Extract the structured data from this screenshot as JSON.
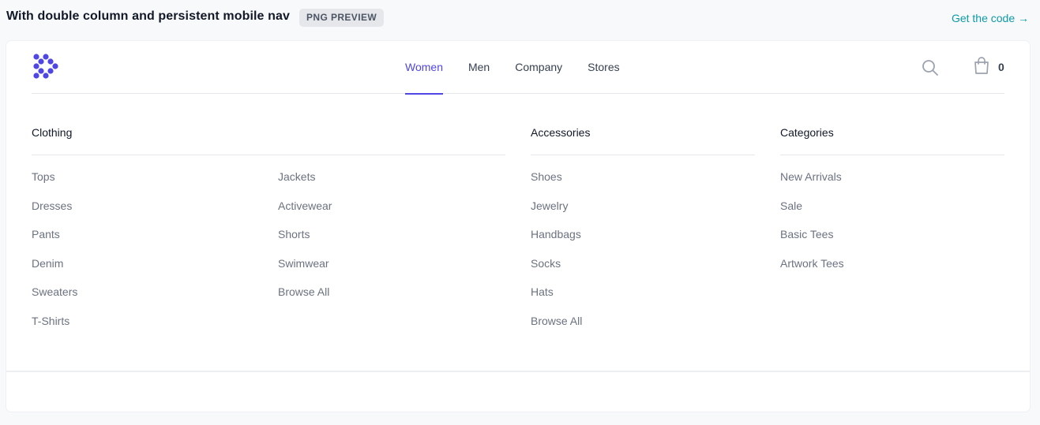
{
  "page": {
    "title": "With double column and persistent mobile nav",
    "badge": "PNG PREVIEW",
    "get_code": "Get the code →"
  },
  "nav": {
    "logo_icon": "workflow-logo-icon",
    "items": [
      {
        "label": "Women",
        "active": true
      },
      {
        "label": "Men"
      },
      {
        "label": "Company"
      },
      {
        "label": "Stores"
      }
    ],
    "search_icon": "search-icon",
    "cart_icon": "shopping-bag-icon",
    "cart_count": "0"
  },
  "menu": {
    "clothing": {
      "title": "Clothing",
      "col1": [
        "Tops",
        "Dresses",
        "Pants",
        "Denim",
        "Sweaters",
        "T-Shirts"
      ],
      "col2": [
        "Jackets",
        "Activewear",
        "Shorts",
        "Swimwear",
        "Browse All"
      ]
    },
    "accessories": {
      "title": "Accessories",
      "items": [
        "Shoes",
        "Jewelry",
        "Handbags",
        "Socks",
        "Hats",
        "Browse All"
      ]
    },
    "categories": {
      "title": "Categories",
      "items": [
        "New Arrivals",
        "Sale",
        "Basic Tees",
        "Artwork Tees"
      ]
    }
  },
  "colors": {
    "accent": "#4f46e5",
    "link": "#0e9aa7",
    "muted_text": "#6b7280"
  }
}
